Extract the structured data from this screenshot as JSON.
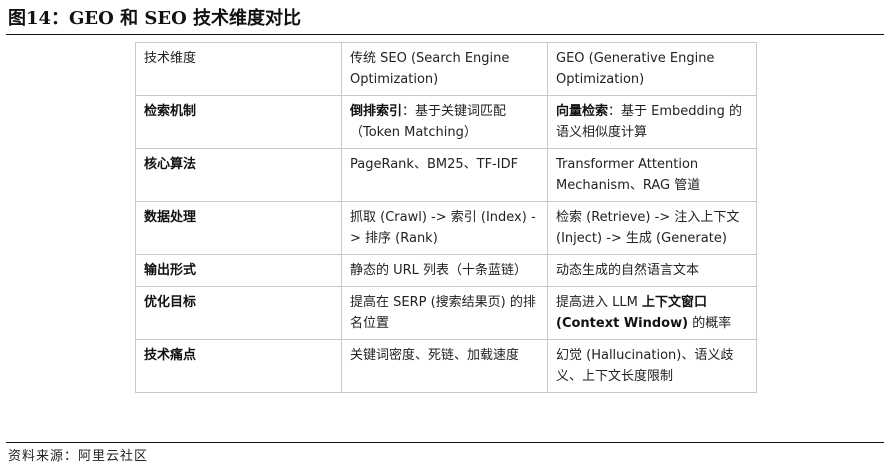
{
  "figure": {
    "title": "图14：GEO 和 SEO 技术维度对比",
    "source": "资料来源：阿里云社区"
  },
  "table": {
    "header": {
      "dimension": "技术维度",
      "seo": "传统 SEO (Search Engine Optimization)",
      "geo": "GEO (Generative Engine Optimization)"
    },
    "rows": [
      {
        "dimension": "检索机制",
        "seo_bold": "倒排索引",
        "seo_text": "：基于关键词匹配（Token Matching）",
        "geo_bold": "向量检索",
        "geo_text": "：基于 Embedding 的语义相似度计算"
      },
      {
        "dimension": "核心算法",
        "seo": "PageRank、BM25、TF-IDF",
        "geo": "Transformer Attention Mechanism、RAG 管道"
      },
      {
        "dimension": "数据处理",
        "seo": "抓取 (Crawl) -> 索引 (Index) -> 排序 (Rank)",
        "geo": "检索 (Retrieve) -> 注入上下文 (Inject) -> 生成 (Generate)"
      },
      {
        "dimension": "输出形式",
        "seo": "静态的 URL 列表（十条蓝链）",
        "geo": "动态生成的自然语言文本"
      },
      {
        "dimension": "优化目标",
        "seo": "提高在 SERP (搜索结果页) 的排名位置",
        "geo_pre": "提高进入 LLM ",
        "geo_bold": "上下文窗口 (Context Window)",
        "geo_post": " 的概率"
      },
      {
        "dimension": "技术痛点",
        "seo": "关键词密度、死链、加载速度",
        "geo": "幻觉 (Hallucination)、语义歧义、上下文长度限制"
      }
    ]
  }
}
